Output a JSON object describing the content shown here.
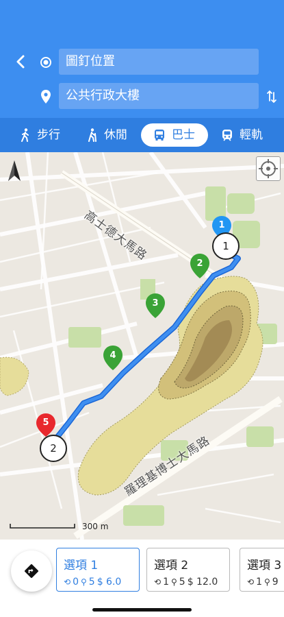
{
  "header": {
    "origin_value": "圖釘位置",
    "destination_value": "公共行政大樓"
  },
  "modes": [
    {
      "label": "步行",
      "icon": "walk-icon"
    },
    {
      "label": "休閒",
      "icon": "hike-icon"
    },
    {
      "label": "巴士",
      "icon": "bus-icon",
      "selected": true
    },
    {
      "label": "輕軌",
      "icon": "train-icon"
    }
  ],
  "map": {
    "streets": [
      "高士德大馬路",
      "羅理基博士大馬路"
    ],
    "scale_label": "300 m",
    "route_color": "#2f7ee0",
    "stops": [
      {
        "label": "1",
        "color": "#2196f3",
        "kind": "origin"
      },
      {
        "label": "2",
        "color": "#3aa336"
      },
      {
        "label": "3",
        "color": "#3aa336"
      },
      {
        "label": "4",
        "color": "#3aa336"
      },
      {
        "label": "5",
        "color": "#e8282d",
        "kind": "destination"
      }
    ],
    "transfer_marks": [
      "1",
      "2"
    ]
  },
  "options": [
    {
      "title": "選項 1",
      "transfers": "0",
      "stops": "5",
      "fare": "$ 6.0",
      "selected": true
    },
    {
      "title": "選項 2",
      "transfers": "1",
      "stops": "5",
      "fare": "$ 12.0"
    },
    {
      "title": "選項 3",
      "transfers": "1",
      "stops": "9",
      "fare": ""
    }
  ],
  "colors": {
    "header": "#3d8ef0",
    "mode_bar": "#2f7ee0",
    "accent": "#2f7ee0"
  }
}
